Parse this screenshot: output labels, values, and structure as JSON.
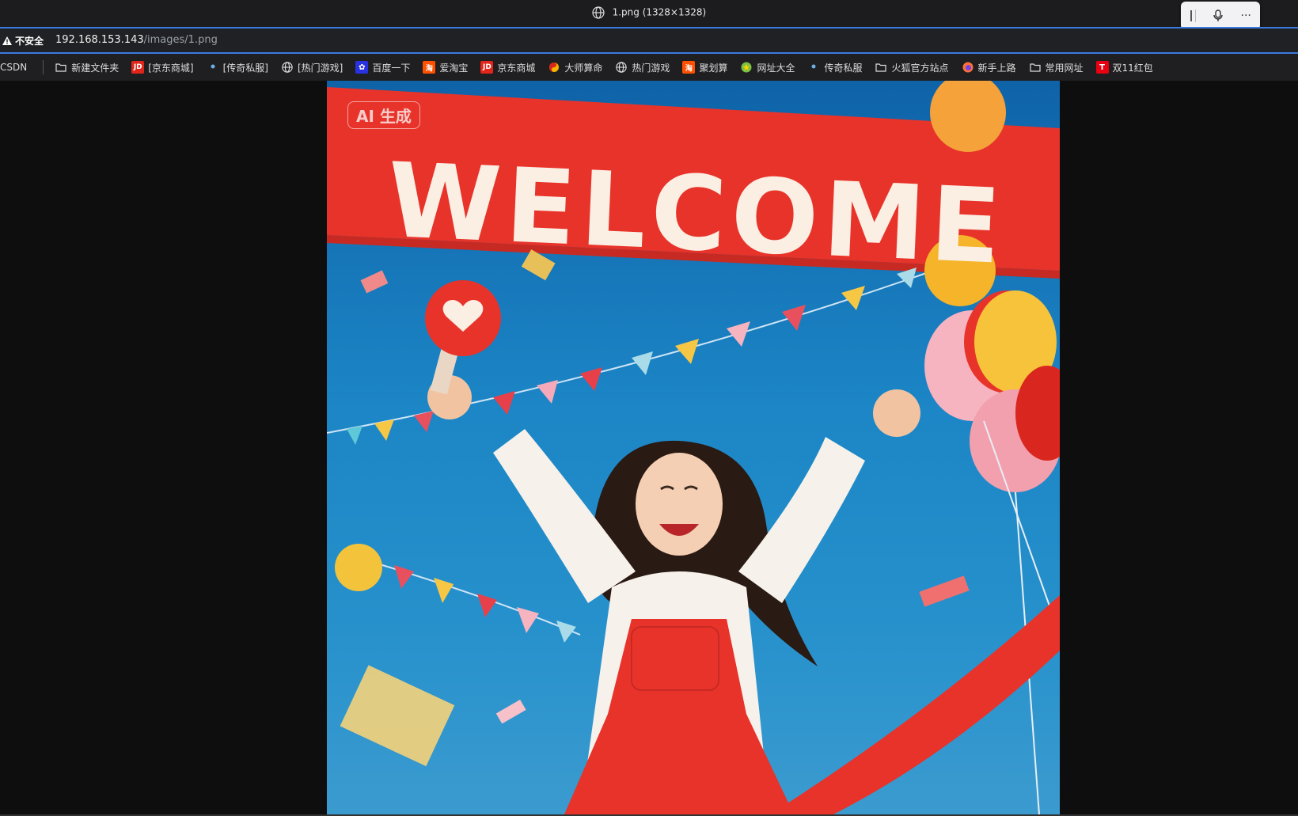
{
  "tab": {
    "title": "1.png (1328×1328)",
    "icon": "globe-icon"
  },
  "toolbar_float": {
    "icons": [
      "drag-handle-icon",
      "microphone-icon",
      "more-icon"
    ],
    "more_label": "···"
  },
  "addressbar": {
    "security_label": "不安全",
    "host": "192.168.153.143",
    "path": "/images/1.png"
  },
  "bookmarks": [
    {
      "label": "CSDN",
      "icon": "none"
    },
    {
      "label": "新建文件夹",
      "icon": "folder-icon"
    },
    {
      "label": "[京东商城]",
      "icon": "jd-icon"
    },
    {
      "label": "[传奇私服]",
      "icon": "dot-icon"
    },
    {
      "label": "[热门游戏]",
      "icon": "globe-icon"
    },
    {
      "label": "百度一下",
      "icon": "baidu-icon"
    },
    {
      "label": "爱淘宝",
      "icon": "taobao-icon"
    },
    {
      "label": "京东商城",
      "icon": "jd-icon"
    },
    {
      "label": "大师算命",
      "icon": "taichi-icon"
    },
    {
      "label": "热门游戏",
      "icon": "globe-icon"
    },
    {
      "label": "聚划算",
      "icon": "taobao-icon"
    },
    {
      "label": "网址大全",
      "icon": "star-icon"
    },
    {
      "label": "传奇私服",
      "icon": "dot-icon"
    },
    {
      "label": "火狐官方站点",
      "icon": "folder-icon"
    },
    {
      "label": "新手上路",
      "icon": "firefox-icon"
    },
    {
      "label": "常用网址",
      "icon": "folder-icon"
    },
    {
      "label": "双11红包",
      "icon": "tmall-icon"
    }
  ],
  "image": {
    "badge": "AI 生成",
    "banner_text": "WELCOME"
  },
  "colors": {
    "accent": "#3b7be0",
    "banner_red": "#e8332a",
    "sky_blue": "#1a80c4"
  }
}
